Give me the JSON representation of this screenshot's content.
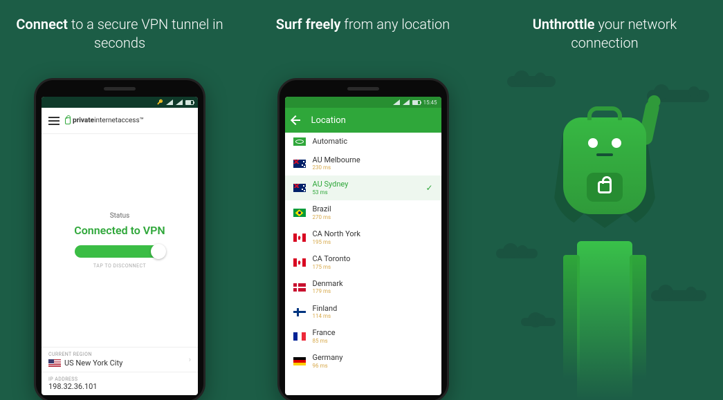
{
  "panel1": {
    "headline_bold": "Connect",
    "headline_rest": " to a secure VPN tunnel in seconds",
    "statusbar": {
      "time": ""
    },
    "brand_bold": "private",
    "brand_rest": "internetaccess™",
    "status_caption": "Status",
    "status_text": "Connected to VPN",
    "tap_hint": "TAP TO DISCONNECT",
    "region_label": "CURRENT REGION",
    "region_value": "US New York City",
    "ip_label": "IP ADDRESS",
    "ip_value": "198.32.36.101"
  },
  "panel2": {
    "headline_bold": "Surf freely",
    "headline_rest": " from any location",
    "statusbar": {
      "time": "15:45"
    },
    "toolbar_title": "Location",
    "locations": [
      {
        "flag": "auto",
        "name": "Automatic",
        "ms": "",
        "selected": false
      },
      {
        "flag": "au",
        "name": "AU Melbourne",
        "ms": "230 ms",
        "selected": false
      },
      {
        "flag": "au",
        "name": "AU Sydney",
        "ms": "53 ms",
        "selected": true
      },
      {
        "flag": "br",
        "name": "Brazil",
        "ms": "270 ms",
        "selected": false
      },
      {
        "flag": "ca",
        "name": "CA North York",
        "ms": "195 ms",
        "selected": false
      },
      {
        "flag": "ca",
        "name": "CA Toronto",
        "ms": "175 ms",
        "selected": false
      },
      {
        "flag": "dk",
        "name": "Denmark",
        "ms": "179 ms",
        "selected": false
      },
      {
        "flag": "fi",
        "name": "Finland",
        "ms": "114 ms",
        "selected": false
      },
      {
        "flag": "fr",
        "name": "France",
        "ms": "85 ms",
        "selected": false
      },
      {
        "flag": "de",
        "name": "Germany",
        "ms": "96 ms",
        "selected": false
      }
    ]
  },
  "panel3": {
    "headline_bold": "Unthrottle",
    "headline_rest": " your network connection"
  }
}
